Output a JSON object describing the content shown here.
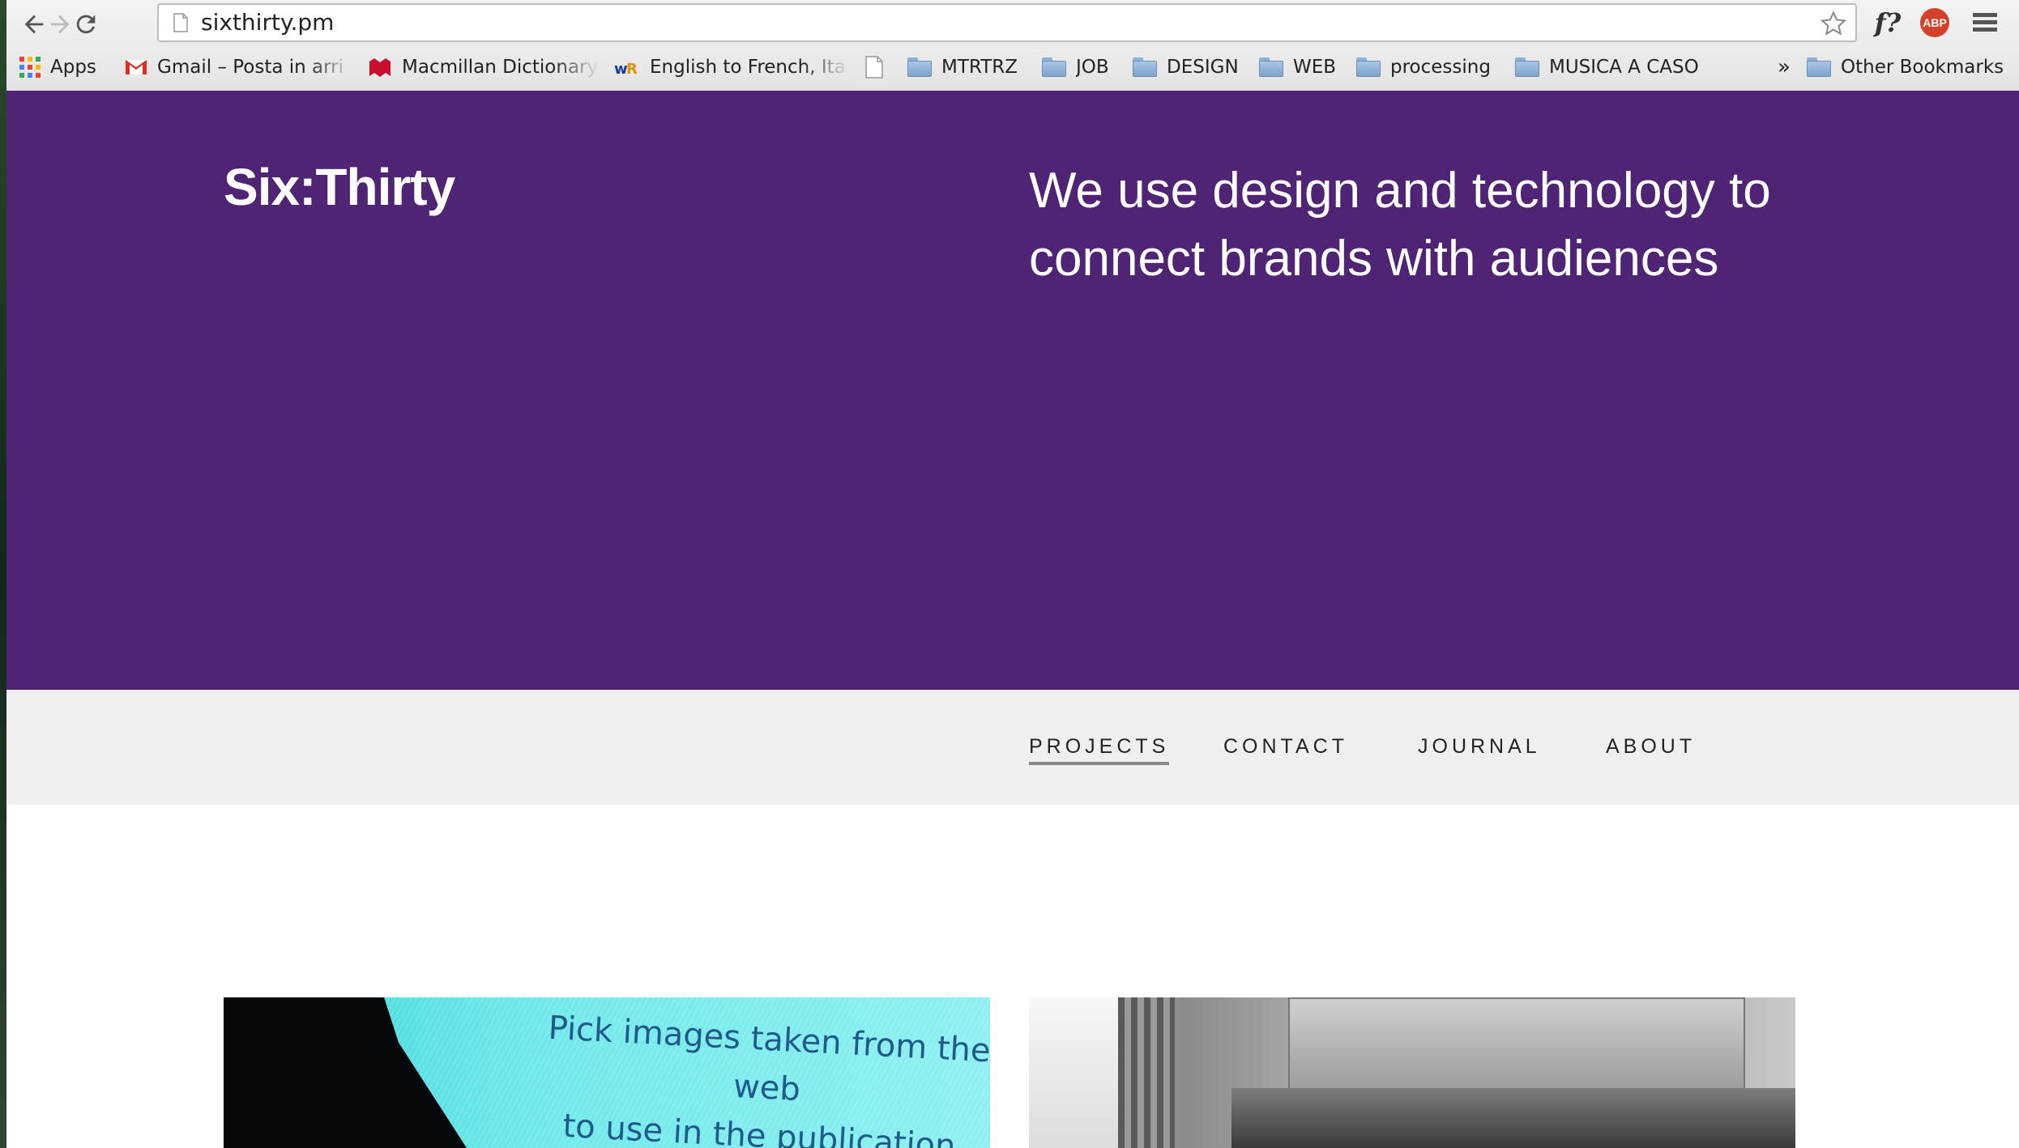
{
  "browser": {
    "url": "sixthirty.pm",
    "extensions": {
      "font_ext_label": "f?",
      "adblock_label": "ABP"
    },
    "bookmarks": [
      {
        "label": "Apps",
        "icon": "apps-grid-icon"
      },
      {
        "label": "Gmail – Posta in arri",
        "icon": "gmail-icon"
      },
      {
        "label": "Macmillan Dictionary",
        "icon": "macmillan-icon"
      },
      {
        "label": "English to French, Ita",
        "icon": "wordreference-icon"
      },
      {
        "label": "",
        "icon": "page-icon"
      },
      {
        "label": "MTRTRZ",
        "icon": "folder-icon"
      },
      {
        "label": "JOB",
        "icon": "folder-icon"
      },
      {
        "label": "DESIGN",
        "icon": "folder-icon"
      },
      {
        "label": "WEB",
        "icon": "folder-icon"
      },
      {
        "label": "processing",
        "icon": "folder-icon"
      },
      {
        "label": "MUSICA A CASO",
        "icon": "folder-icon"
      }
    ],
    "overflow_label": "»",
    "other_bookmarks": "Other Bookmarks"
  },
  "site": {
    "logo": "Six:Thirty",
    "tagline": "We use design and technology to connect brands with audiences",
    "nav": [
      {
        "label": "PROJECTS",
        "active": true
      },
      {
        "label": "CONTACT",
        "active": false
      },
      {
        "label": "JOURNAL",
        "active": false
      },
      {
        "label": "ABOUT",
        "active": false
      }
    ],
    "projects": [
      {
        "caption_line1": "Pick images taken from the web",
        "caption_line2": "to use in the publication."
      }
    ]
  },
  "colors": {
    "hero": "#4f2474",
    "navbar": "#efefef",
    "text_light": "#ffffff"
  }
}
